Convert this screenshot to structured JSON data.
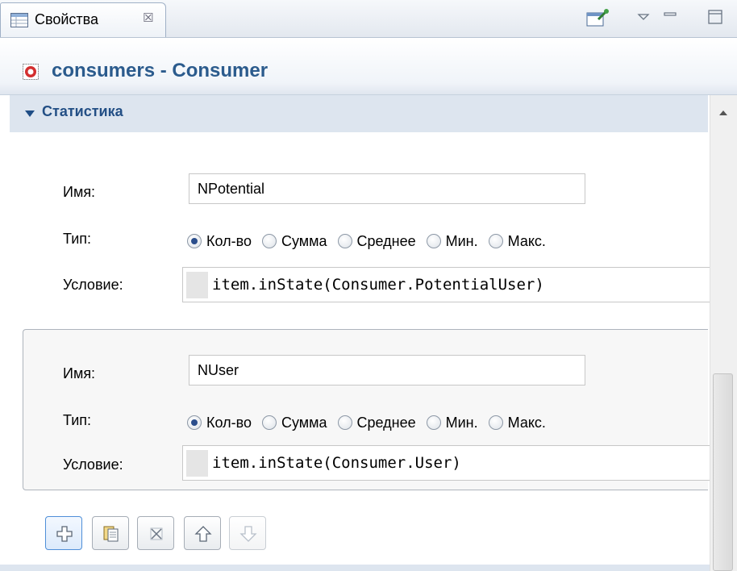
{
  "tab": {
    "label": "Свойства",
    "close_glyph": "☒"
  },
  "header": {
    "title": "consumers - Consumer",
    "icon": "agent-icon"
  },
  "section": {
    "title": "Статистика",
    "expanded": true
  },
  "stats": [
    {
      "name_label": "Имя:",
      "name_value": "NPotential",
      "type_label": "Тип:",
      "type_options": [
        "Кол-во",
        "Сумма",
        "Среднее",
        "Мин.",
        "Макс."
      ],
      "type_selected": "Кол-во",
      "condition_label": "Условие:",
      "condition_value": "item.inState(Consumer.PotentialUser)"
    },
    {
      "name_label": "Имя:",
      "name_value": "NUser",
      "type_label": "Тип:",
      "type_options": [
        "Кол-во",
        "Сумма",
        "Среднее",
        "Мин.",
        "Макс."
      ],
      "type_selected": "Кол-во",
      "condition_label": "Условие:",
      "condition_value": "item.inState(Consumer.User)"
    }
  ],
  "actions": [
    {
      "name": "add-icon",
      "enabled": true
    },
    {
      "name": "copy-icon",
      "enabled": true
    },
    {
      "name": "delete-icon",
      "enabled": true
    },
    {
      "name": "move-up-icon",
      "enabled": true
    },
    {
      "name": "move-down-icon",
      "enabled": false
    }
  ],
  "colors": {
    "header_title": "#2b5b8d",
    "section_bar": "#dde5ef",
    "radio_selected": "#2b4e8c"
  }
}
